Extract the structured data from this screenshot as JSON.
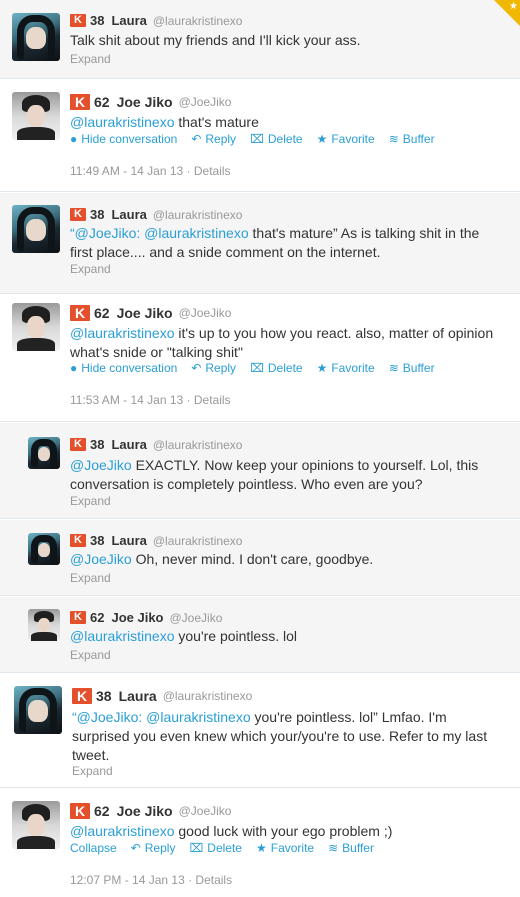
{
  "tweets": [
    {
      "user": "Laura",
      "handle": "@laurakristinexo",
      "score": "38",
      "text": "Talk shit about my friends and I'll kick your ass.",
      "expand": "Expand"
    },
    {
      "user": "Joe Jiko",
      "handle": "@JoeJiko",
      "score": "62",
      "mention": "@laurakristinexo",
      "text": " that's mature",
      "meta": "11:49 AM - 14 Jan 13 · Details",
      "actions": {
        "hide": "Hide conversation",
        "reply": "Reply",
        "delete": "Delete",
        "favorite": "Favorite",
        "buffer": "Buffer"
      }
    },
    {
      "user": "Laura",
      "handle": "@laurakristinexo",
      "score": "38",
      "quote_open": "“",
      "mention1": "@JoeJiko",
      "sep": ": ",
      "mention2": "@laurakristinexo",
      "text": " that's mature” As is talking shit in the first place.... and a snide comment on the internet.",
      "expand": "Expand"
    },
    {
      "user": "Joe Jiko",
      "handle": "@JoeJiko",
      "score": "62",
      "mention": "@laurakristinexo",
      "text": " it's up to you how you react. also, matter of opinion what's snide or \"talking shit\"",
      "meta": "11:53 AM - 14 Jan 13 · Details",
      "actions": {
        "hide": "Hide conversation",
        "reply": "Reply",
        "delete": "Delete",
        "favorite": "Favorite",
        "buffer": "Buffer"
      }
    },
    {
      "user": "Laura",
      "handle": "@laurakristinexo",
      "score": "38",
      "mention": "@JoeJiko",
      "text": " EXACTLY. Now keep your opinions to yourself. Lol, this conversation is completely pointless. Who even are you?",
      "expand": "Expand"
    },
    {
      "user": "Laura",
      "handle": "@laurakristinexo",
      "score": "38",
      "mention": "@JoeJiko",
      "text": " Oh, never mind. I don't care, goodbye.",
      "expand": "Expand"
    },
    {
      "user": "Joe Jiko",
      "handle": "@JoeJiko",
      "score": "62",
      "mention": "@laurakristinexo",
      "text": " you're pointless. lol",
      "expand": "Expand"
    },
    {
      "user": "Laura",
      "handle": "@laurakristinexo",
      "score": "38",
      "quote_open": "“",
      "mention1": "@JoeJiko",
      "sep": ": ",
      "mention2": "@laurakristinexo",
      "text": " you're pointless. lol” Lmfao. I'm surprised you even knew which your/you're to use. Refer to my last tweet.",
      "expand": "Expand"
    },
    {
      "user": "Joe Jiko",
      "handle": "@JoeJiko",
      "score": "62",
      "mention": "@laurakristinexo",
      "text": " good luck with your ego problem ;)",
      "meta": "12:07 PM - 14 Jan 13 · Details",
      "actions": {
        "collapse": "Collapse",
        "reply": "Reply",
        "delete": "Delete",
        "favorite": "Favorite",
        "buffer": "Buffer"
      }
    }
  ],
  "klout_glyph": "K",
  "icons": {
    "conversation": "speech-bubble-icon",
    "reply": "reply-arrow-icon",
    "delete": "trash-icon",
    "favorite": "star-icon",
    "buffer": "buffer-stack-icon",
    "corner": "star-icon"
  },
  "colors": {
    "link": "#2a9fd6",
    "klout": "#e4502c",
    "muted": "#999999",
    "alt_row": "#f5f5f5",
    "favorited_corner": "#f0b800"
  }
}
